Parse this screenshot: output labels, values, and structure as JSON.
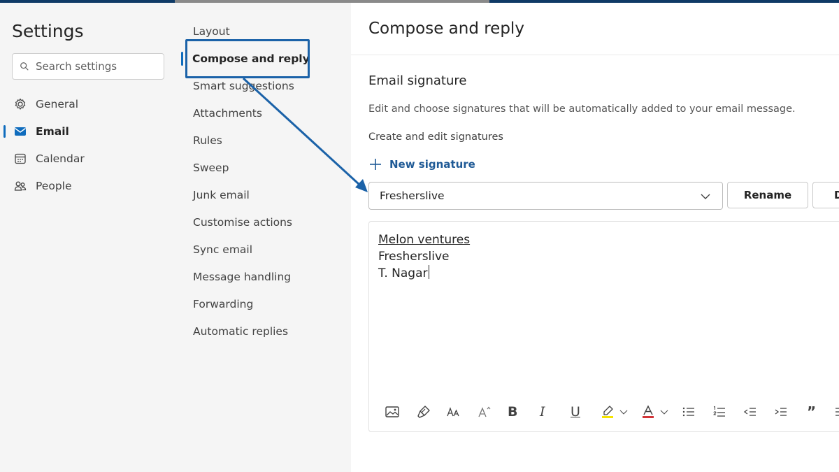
{
  "settings": {
    "title": "Settings",
    "search_placeholder": "Search settings"
  },
  "nav": {
    "items": [
      {
        "label": "General",
        "icon": "gear-icon"
      },
      {
        "label": "Email",
        "icon": "mail-icon",
        "active": true
      },
      {
        "label": "Calendar",
        "icon": "calendar-icon"
      },
      {
        "label": "People",
        "icon": "people-icon"
      }
    ]
  },
  "subnav": {
    "items": [
      "Layout",
      "Compose and reply",
      "Smart suggestions",
      "Attachments",
      "Rules",
      "Sweep",
      "Junk email",
      "Customise actions",
      "Sync email",
      "Message handling",
      "Forwarding",
      "Automatic replies"
    ],
    "active": "Compose and reply"
  },
  "main": {
    "title": "Compose and reply",
    "section_title": "Email signature",
    "section_desc": "Edit and choose signatures that will be automatically added to your email message.",
    "create_heading": "Create and edit signatures",
    "new_signature_label": "New signature",
    "selected_signature": "Fresherslive",
    "rename_label": "Rename",
    "delete_label": "D",
    "signature_lines": [
      "Melon ventures",
      "Fresherslive",
      "T. Nagar"
    ]
  },
  "toolbar": {
    "bold": "B",
    "italic": "I",
    "underline": "U",
    "quote": "”"
  },
  "colors": {
    "accent": "#0f6cbd",
    "annotation": "#1b62a8",
    "link": "#1f5a96",
    "highlight": "#f5e400",
    "font_color": "#d13438"
  }
}
